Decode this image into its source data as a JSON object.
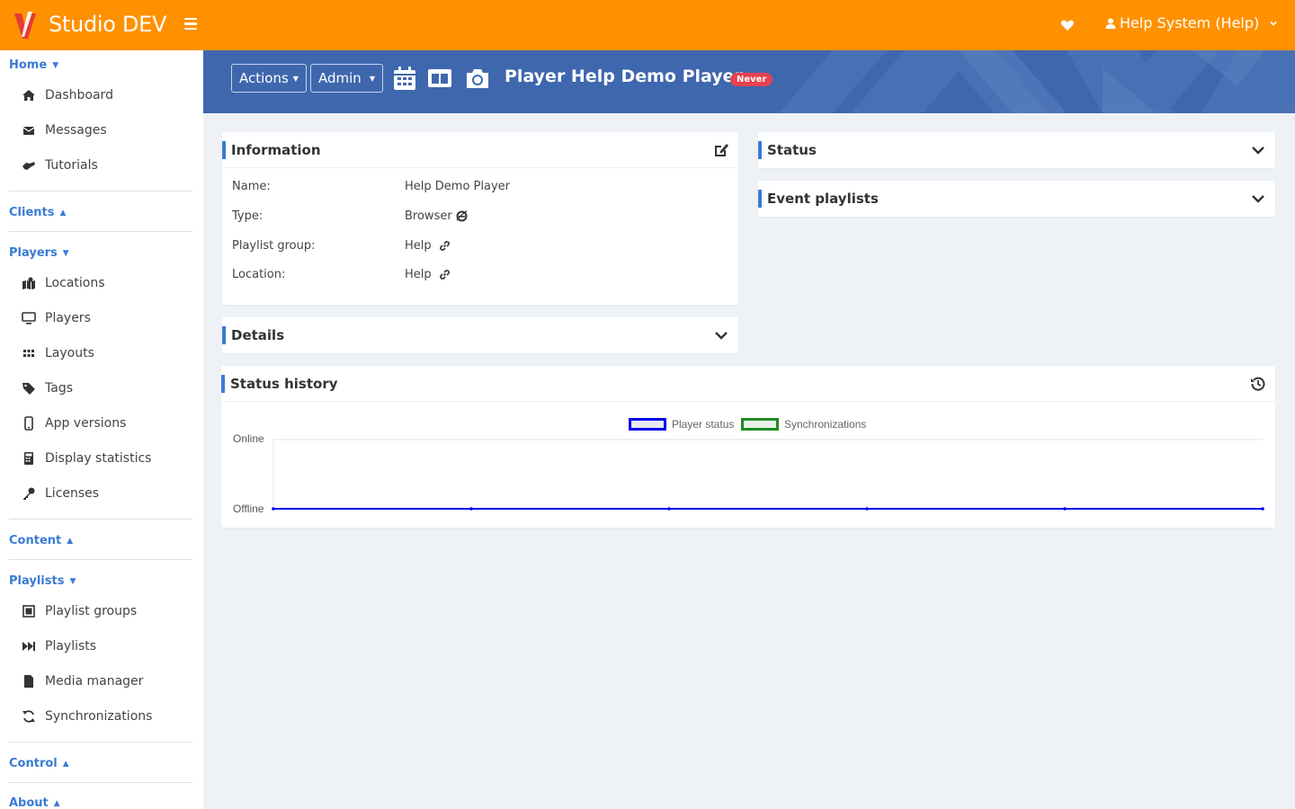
{
  "app": {
    "title": "Studio DEV"
  },
  "topbar": {
    "user_label": "Help System (Help)"
  },
  "sidebar": {
    "home": {
      "label": "Home",
      "items": [
        "Dashboard",
        "Messages",
        "Tutorials"
      ]
    },
    "clients": {
      "label": "Clients"
    },
    "players": {
      "label": "Players",
      "items": [
        "Locations",
        "Players",
        "Layouts",
        "Tags",
        "App versions",
        "Display statistics",
        "Licenses"
      ]
    },
    "content": {
      "label": "Content"
    },
    "playlists": {
      "label": "Playlists",
      "items": [
        "Playlist groups",
        "Playlists",
        "Media manager",
        "Synchronizations"
      ]
    },
    "control": {
      "label": "Control"
    },
    "about": {
      "label": "About"
    }
  },
  "header": {
    "actions_label": "Actions",
    "admin_label": "Admin",
    "title": "Player Help Demo Player",
    "badge": "Never"
  },
  "information": {
    "title": "Information",
    "rows": [
      {
        "label": "Name:",
        "value": "Help Demo Player"
      },
      {
        "label": "Type:",
        "value": "Browser"
      },
      {
        "label": "Playlist group:",
        "value": "Help"
      },
      {
        "label": "Location:",
        "value": "Help"
      }
    ]
  },
  "details": {
    "title": "Details"
  },
  "status": {
    "title": "Status"
  },
  "event_playlists": {
    "title": "Event playlists"
  },
  "status_history": {
    "title": "Status history"
  },
  "chart_data": {
    "type": "line",
    "title": "",
    "series": [
      {
        "name": "Player status",
        "color": "#0000ee",
        "values": [
          0,
          0,
          0,
          0,
          0,
          0
        ]
      },
      {
        "name": "Synchronizations",
        "color": "#228b22",
        "values": []
      }
    ],
    "y_categories": [
      "Offline",
      "Online"
    ],
    "ylim": [
      0,
      1
    ],
    "legend": "top-center",
    "grid": true
  },
  "colors": {
    "topbar": "#ff9100",
    "banner": "#3f67ad",
    "accent": "#3a7bd5",
    "badge": "#e8414f"
  }
}
